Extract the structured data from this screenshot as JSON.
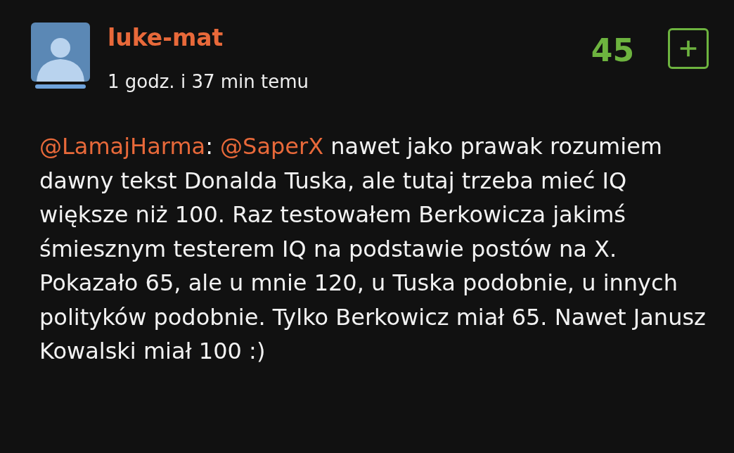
{
  "comment": {
    "author": "luke-mat",
    "time": "1 godz. i 37 min temu",
    "score": "45",
    "upvoted": false,
    "body": [
      {
        "kind": "mention",
        "text": "@LamajHarma"
      },
      {
        "kind": "text",
        "text": ": "
      },
      {
        "kind": "mention",
        "text": "@SaperX"
      },
      {
        "kind": "text",
        "text": " nawet jako prawak rozumiem dawny tekst Donalda Tuska, ale tutaj trzeba mieć IQ większe niż 100. Raz testowałem Berkowicza jakimś śmiesznym testerem IQ na podstawie postów na X. Pokazało 65, ale u mnie 120, u Tuska podobnie, u innych polityków podobnie. Tylko Berkowicz miał 65. Nawet Janusz Kowalski miał 100 :)"
      }
    ]
  }
}
